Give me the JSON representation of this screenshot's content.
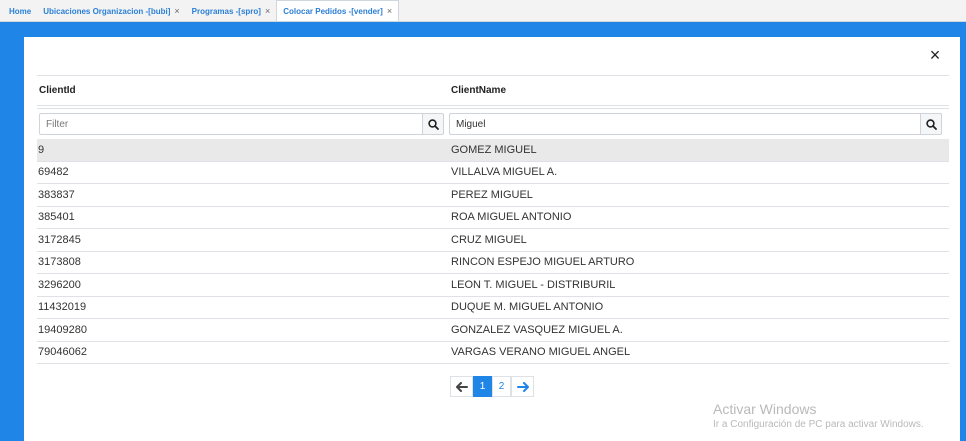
{
  "tabs": [
    {
      "label": "Home",
      "closable": false
    },
    {
      "label": "Ubicaciones Organizacion -[bubi]",
      "closable": true
    },
    {
      "label": "Programas -[spro]",
      "closable": true
    },
    {
      "label": "Colocar Pedidos -[vender]",
      "closable": true,
      "active": true
    }
  ],
  "tab_close_glyph": "×",
  "modal": {
    "close_glyph": "×",
    "columns": {
      "id": "ClientId",
      "name": "ClientName"
    },
    "filters": {
      "id": {
        "value": "",
        "placeholder": "Filter"
      },
      "name": {
        "value": "Miguel",
        "placeholder": "Filter"
      }
    },
    "rows": [
      {
        "id": "9",
        "name": "GOMEZ MIGUEL"
      },
      {
        "id": "69482",
        "name": "VILLALVA MIGUEL A."
      },
      {
        "id": "383837",
        "name": "PEREZ MIGUEL"
      },
      {
        "id": "385401",
        "name": "ROA MIGUEL ANTONIO"
      },
      {
        "id": "3172845",
        "name": "CRUZ MIGUEL"
      },
      {
        "id": "3173808",
        "name": "RINCON ESPEJO MIGUEL ARTURO"
      },
      {
        "id": "3296200",
        "name": "LEON T. MIGUEL - DISTRIBURIL"
      },
      {
        "id": "11432019",
        "name": "DUQUE M. MIGUEL ANTONIO"
      },
      {
        "id": "19409280",
        "name": "GONZALEZ VASQUEZ MIGUEL A."
      },
      {
        "id": "79046062",
        "name": "VARGAS VERANO MIGUEL ANGEL"
      }
    ],
    "pagination": {
      "pages": [
        "1",
        "2"
      ],
      "current": "1",
      "prev_glyph": "🡐",
      "next_glyph": "🡒"
    }
  },
  "watermark": {
    "line1": "Activar Windows",
    "line2": "Ir a Configuración de PC para activar Windows."
  },
  "colors": {
    "accent": "#1f86e8",
    "selected_row": "#e9e9e9"
  }
}
